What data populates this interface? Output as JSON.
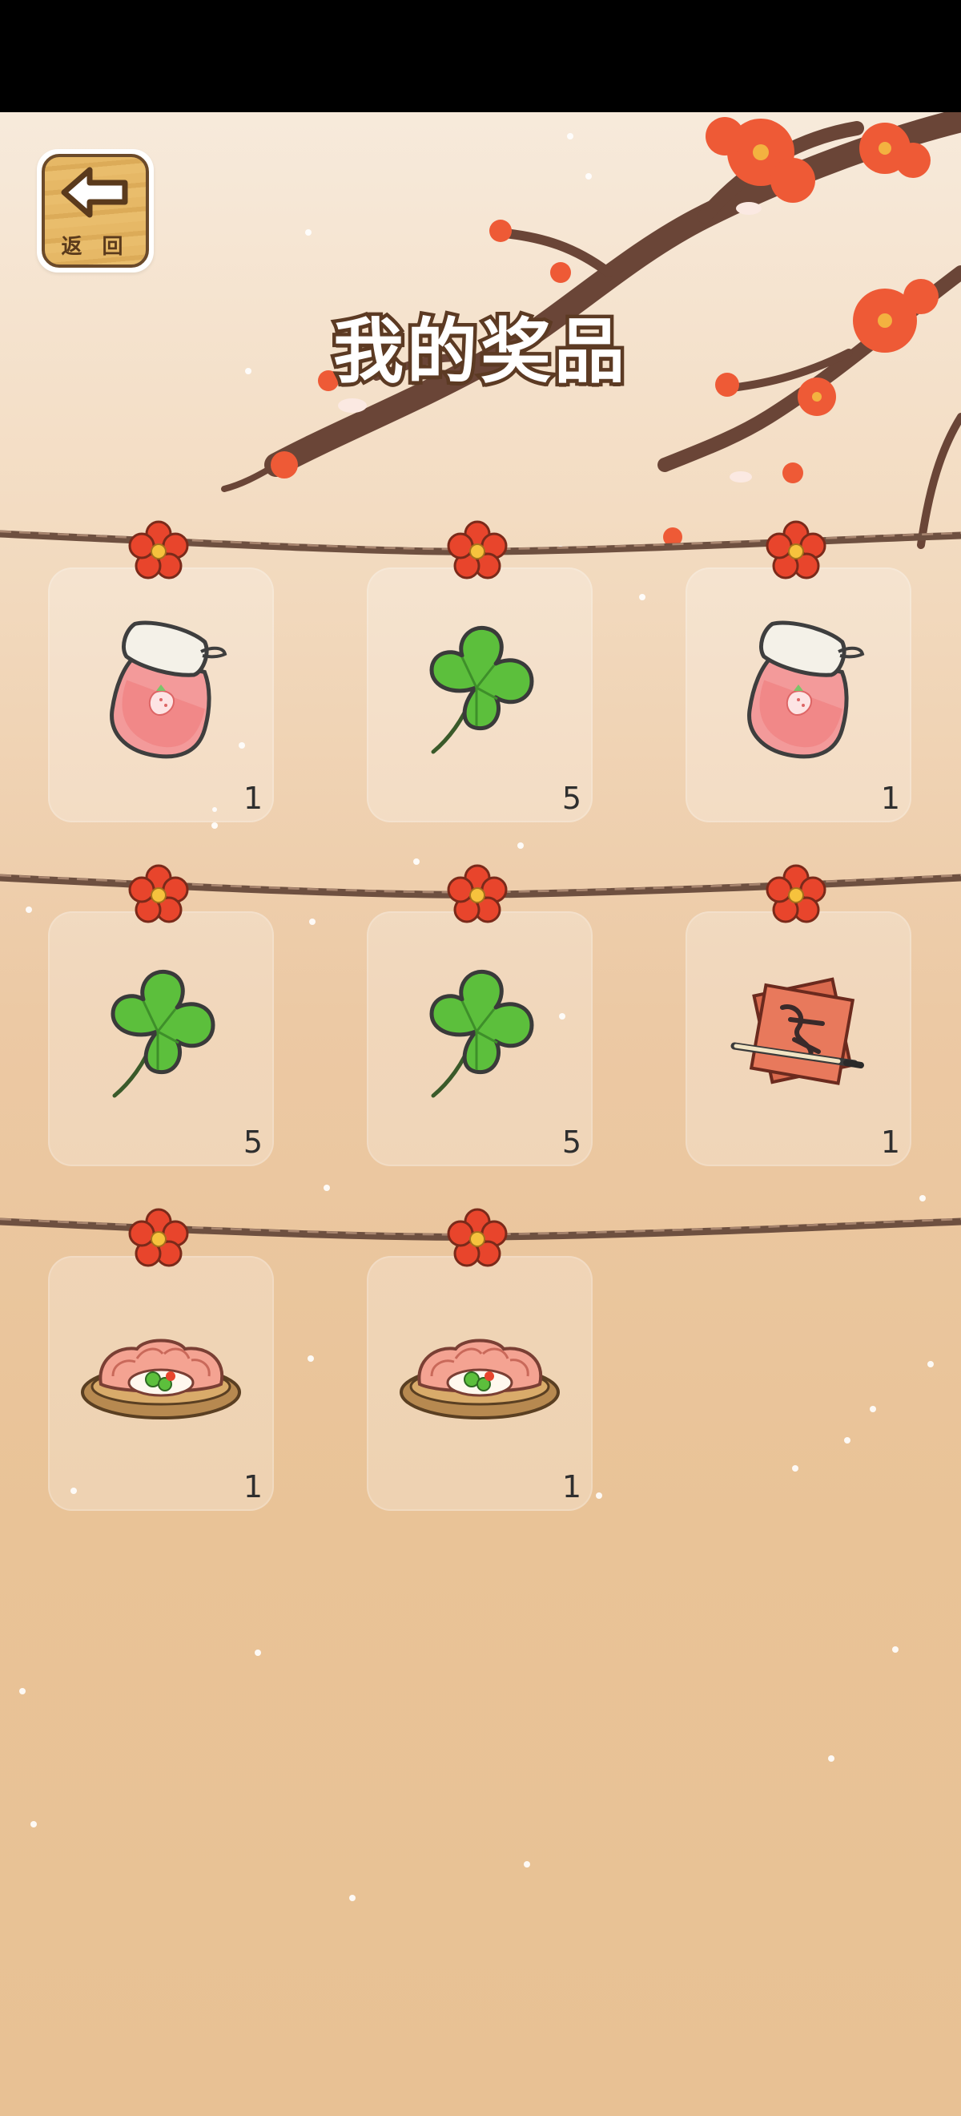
{
  "header": {
    "title": "我的奖品",
    "back_label": "返 回"
  },
  "prizes": [
    {
      "item": "strawberry-jam-jar",
      "count": "1"
    },
    {
      "item": "four-leaf-clover",
      "count": "5"
    },
    {
      "item": "strawberry-jam-jar",
      "count": "1"
    },
    {
      "item": "four-leaf-clover",
      "count": "5"
    },
    {
      "item": "four-leaf-clover",
      "count": "5"
    },
    {
      "item": "calligraphy-couplet",
      "count": "1"
    },
    {
      "item": "dumplings-on-bamboo-tray",
      "count": "1"
    },
    {
      "item": "dumplings-on-bamboo-tray",
      "count": "1"
    }
  ],
  "colors": {
    "title_outline": "#5c3a23",
    "flower": "#e8452c",
    "clover": "#5cbf3c",
    "background_top": "#f7eadb",
    "background_bottom": "#e8c194"
  }
}
